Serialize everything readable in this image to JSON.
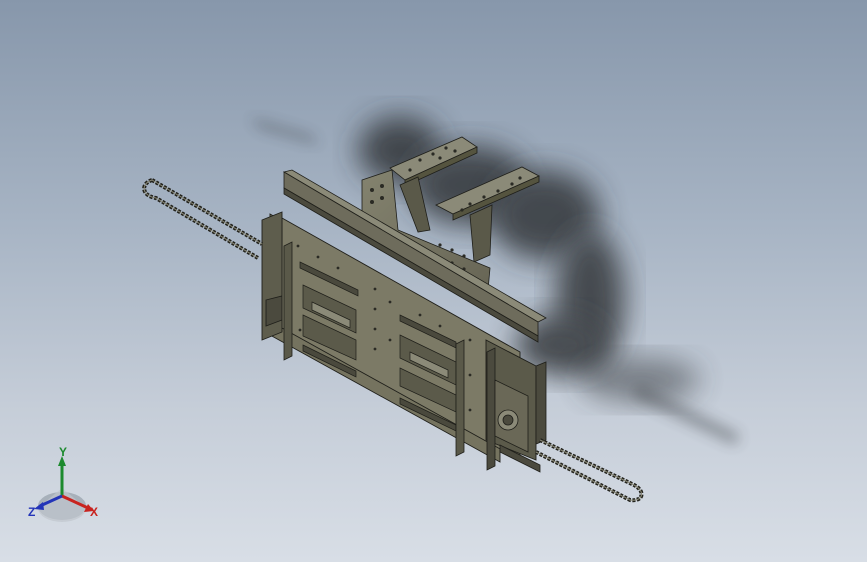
{
  "viewport": {
    "background_top": "#8797ab",
    "background_bottom": "#d8dee6"
  },
  "model": {
    "body_color": "#6e6c5c",
    "body_light": "#8b8a78",
    "body_dark": "#4b4a3e",
    "edge_color": "#1f1f1a",
    "shadow_color": "#2e2f30"
  },
  "triad": {
    "x_label": "X",
    "y_label": "Y",
    "z_label": "Z",
    "x_color": "#c8231f",
    "y_color": "#1c8a2e",
    "z_color": "#2334b8",
    "icon": "axis-triad-icon"
  }
}
